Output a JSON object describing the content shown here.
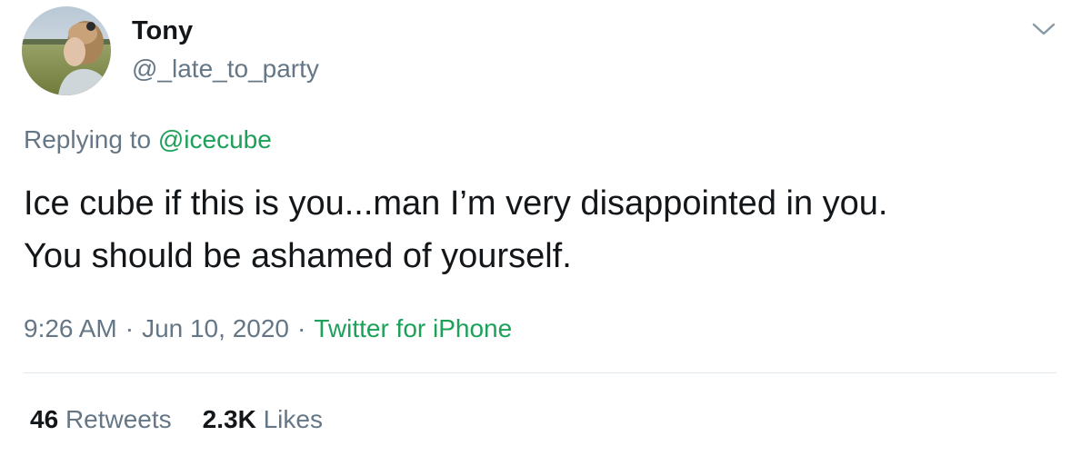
{
  "tweet": {
    "author": {
      "name": "Tony",
      "handle": "@_late_to_party"
    },
    "replying": {
      "prefix": "Replying to",
      "mention": "@icecube"
    },
    "text_lines": [
      "Ice cube if this is you...man I’m very disappointed in you.",
      "You should be ashamed of yourself."
    ],
    "meta": {
      "time": "9:26 AM",
      "separator": "·",
      "date": "Jun 10, 2020",
      "source": "Twitter for iPhone"
    },
    "stats": {
      "retweets_count": "46",
      "retweets_label": "Retweets",
      "likes_count": "2.3K",
      "likes_label": "Likes"
    },
    "icons": {
      "menu": "chevron-down-icon"
    },
    "colors": {
      "link": "#1da15a",
      "secondary_text": "#657786",
      "primary_text": "#14171a",
      "divider": "#e1e8ed"
    }
  }
}
